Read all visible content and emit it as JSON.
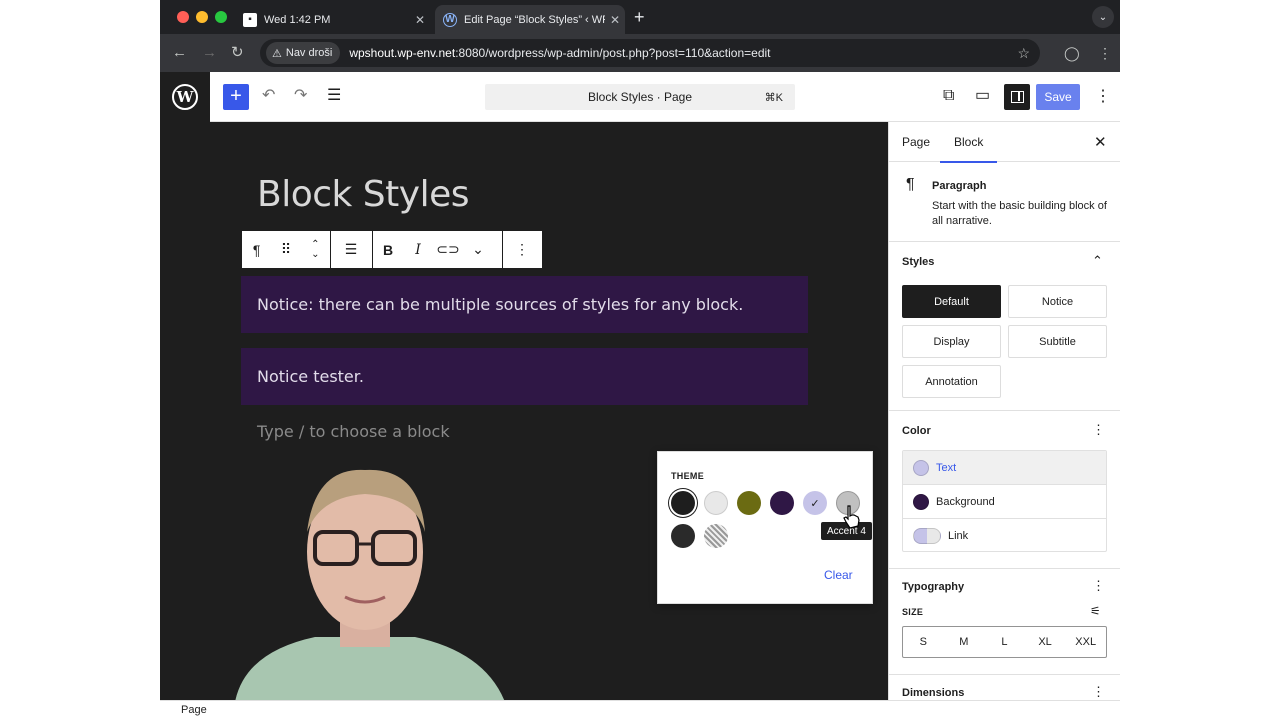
{
  "browser": {
    "tabs": [
      {
        "title": "Wed 1:42 PM",
        "favicon": "square-logo-icon"
      },
      {
        "title": "Edit Page “Block Styles” ‹ WP",
        "favicon": "wordpress-icon",
        "active": true
      }
    ],
    "security_label": "Nav droši",
    "url_host": "wpshout.wp-env.net",
    "url_rest": ":8080/wordpress/wp-admin/post.php?post=110&action=edit"
  },
  "editor": {
    "command_bar": "Block Styles · Page",
    "command_shortcut": "⌘K",
    "save_label": "Save",
    "page_title": "Block Styles",
    "blocks": [
      "Notice: there can be multiple sources of styles for any block.",
      "Notice tester."
    ],
    "placeholder": "Type / to choose a block",
    "footer_breadcrumb": "Page"
  },
  "popover": {
    "section_label": "THEME",
    "swatches": [
      {
        "color": "#1e1e1e",
        "selected_ring": true
      },
      {
        "color": "#e8e8e8"
      },
      {
        "color": "#6b6b12"
      },
      {
        "color": "#2f1745"
      },
      {
        "color": "#c5c3e8",
        "checked": true
      },
      {
        "color": "#c0c0c0"
      },
      {
        "color": "#2a2a2a"
      },
      {
        "color": "pattern"
      }
    ],
    "tooltip": "Accent 4",
    "clear_label": "Clear"
  },
  "sidebar": {
    "tabs": [
      "Page",
      "Block"
    ],
    "active_tab": "Block",
    "block_name": "Paragraph",
    "block_desc": "Start with the basic building block of all narrative.",
    "styles_title": "Styles",
    "styles": [
      "Default",
      "Notice",
      "Display",
      "Subtitle",
      "Annotation"
    ],
    "selected_style": "Default",
    "color_title": "Color",
    "color_items": [
      {
        "label": "Text",
        "color": "#c5c3e8"
      },
      {
        "label": "Background",
        "color": "#2f1745"
      },
      {
        "label": "Link",
        "color": "pair"
      }
    ],
    "typography_title": "Typography",
    "size_label": "SIZE",
    "sizes": [
      "S",
      "M",
      "L",
      "XL",
      "XXL"
    ],
    "dimensions_title": "Dimensions"
  },
  "colors": {
    "accent": "#3858e9",
    "notice_bg": "#2f1745",
    "canvas_bg": "#1e1e1e"
  }
}
